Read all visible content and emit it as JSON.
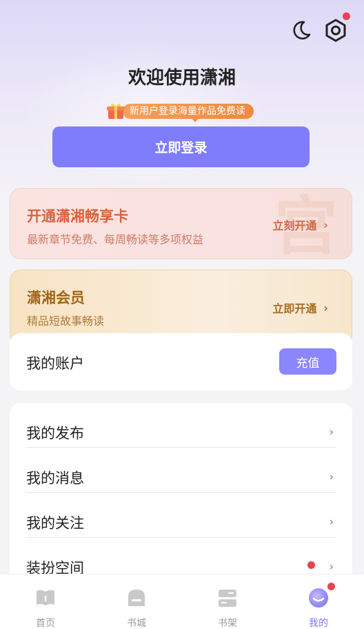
{
  "header": {
    "welcome_title": "欢迎使用潇湘",
    "promo_text": "新用户登录海量作品免费读",
    "login_button": "立即登录"
  },
  "vip_card": {
    "title": "开通潇湘畅享卡",
    "subtitle": "最新章节免费、每周畅读等多项权益",
    "action": "立刻开通",
    "chevron": "›"
  },
  "member_card": {
    "title": "潇湘会员",
    "subtitle": "精品短故事畅读",
    "action": "立即开通",
    "chevron": "›"
  },
  "account": {
    "label": "我的账户",
    "recharge_button": "充值"
  },
  "menu": {
    "items": [
      {
        "label": "我的发布",
        "chevron": "›"
      },
      {
        "label": "我的消息",
        "chevron": "›"
      },
      {
        "label": "我的关注",
        "chevron": "›"
      },
      {
        "label": "装扮空间",
        "chevron": "›"
      }
    ]
  },
  "tabbar": {
    "tabs": [
      {
        "label": "首页",
        "icon": "home-book-icon"
      },
      {
        "label": "书城",
        "icon": "bookstore-icon"
      },
      {
        "label": "书架",
        "icon": "bookshelf-icon"
      },
      {
        "label": "我的",
        "icon": "profile-icon"
      }
    ]
  },
  "colors": {
    "accent": "#7f7dfb",
    "badge_red": "#e8434b",
    "vip_orange": "#d9623c",
    "member_gold": "#a0651a"
  }
}
